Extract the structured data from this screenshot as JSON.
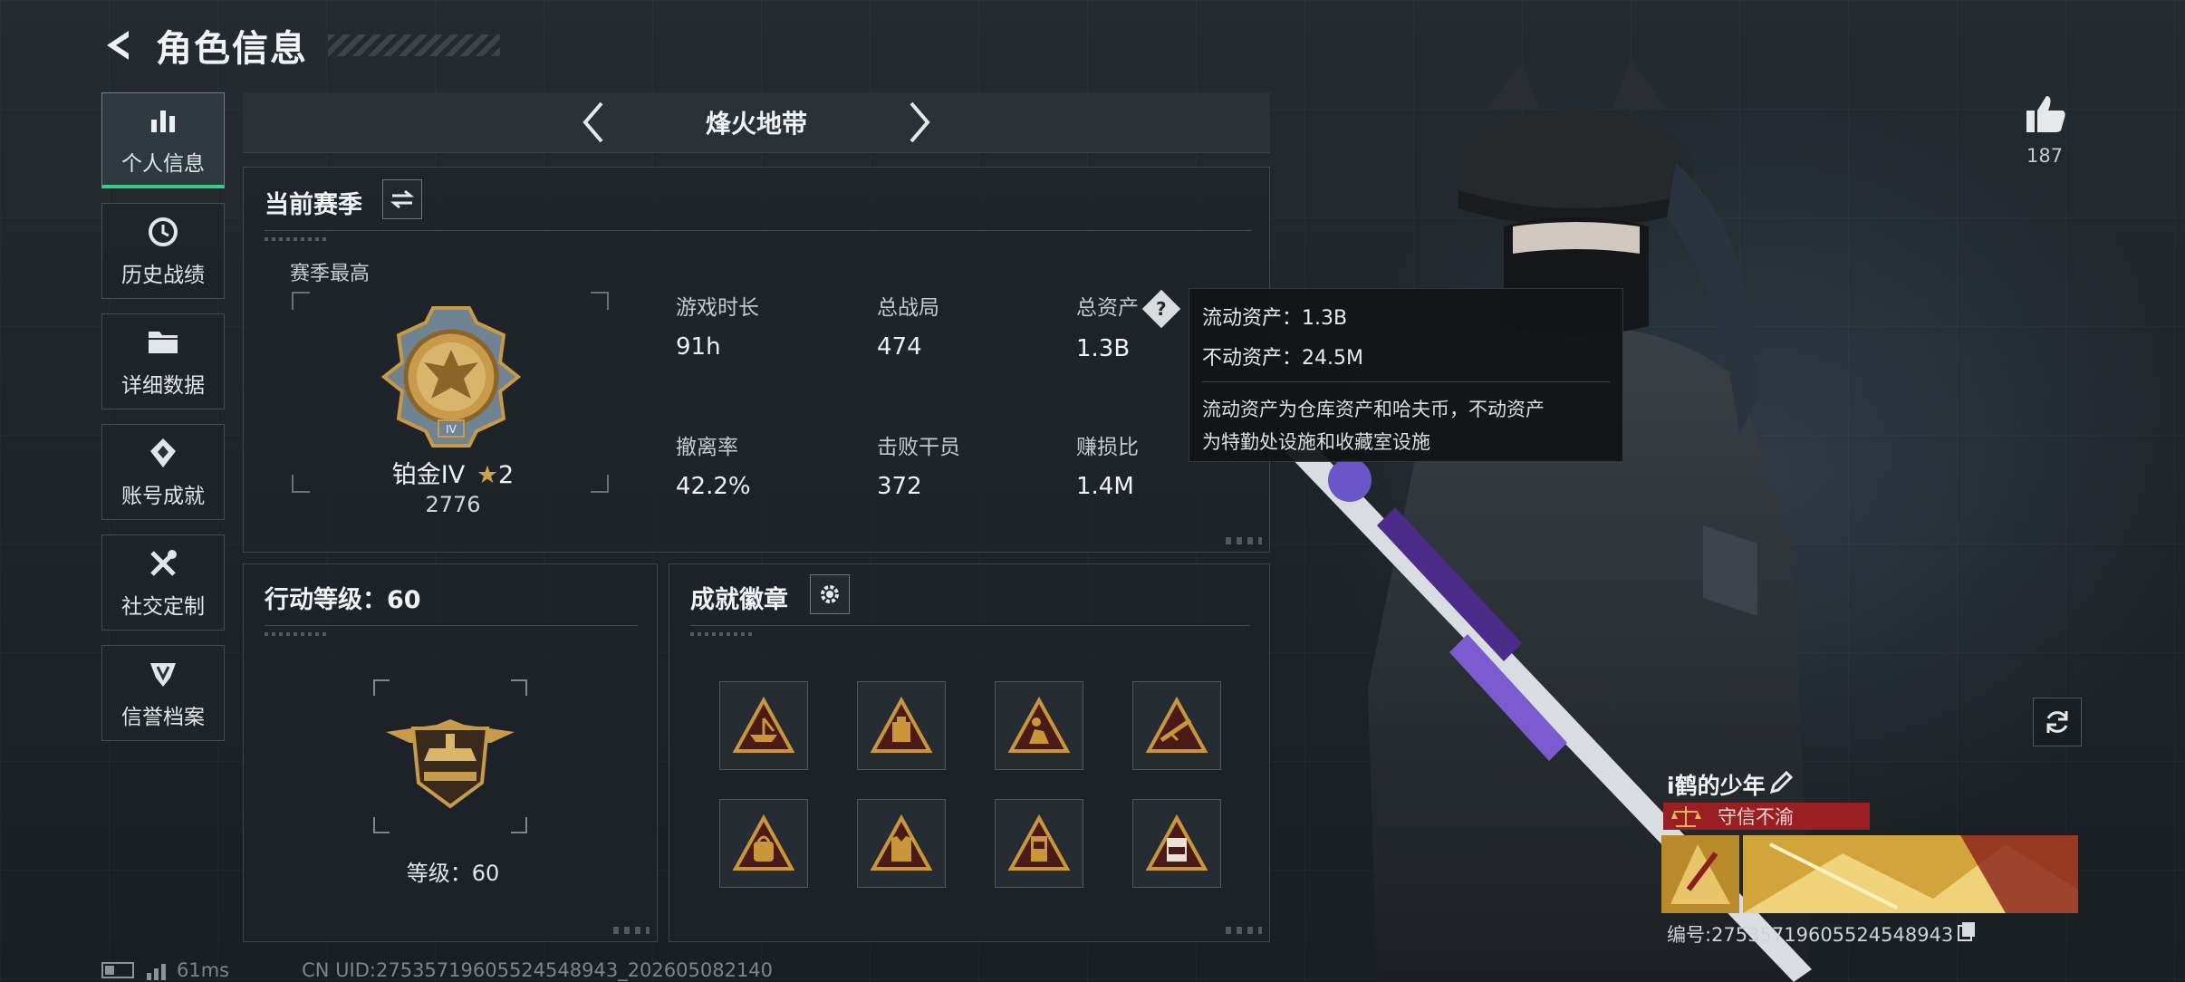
{
  "header": {
    "title": "角色信息"
  },
  "sidebar": {
    "items": [
      {
        "label": "个人信息",
        "active": true
      },
      {
        "label": "历史战绩"
      },
      {
        "label": "详细数据"
      },
      {
        "label": "账号成就"
      },
      {
        "label": "社交定制"
      },
      {
        "label": "信誉档案"
      }
    ]
  },
  "mode": {
    "name": "烽火地带"
  },
  "season": {
    "title": "当前赛季",
    "best_label": "赛季最高",
    "rank_name": "铂金IV",
    "rank_stars": "2",
    "rank_score": "2776",
    "stats": [
      {
        "label": "游戏时长",
        "value": "91h"
      },
      {
        "label": "总战局",
        "value": "474"
      },
      {
        "label": "总资产",
        "value": "1.3B"
      },
      {
        "label": "撤离率",
        "value": "42.2%"
      },
      {
        "label": "击败干员",
        "value": "372"
      },
      {
        "label": "赚损比",
        "value": "1.4M"
      }
    ],
    "help_glyph": "?"
  },
  "tooltip": {
    "liquid": "流动资产：1.3B",
    "fixed": "不动资产：24.5M",
    "desc_line1": "流动资产为仓库资产和哈夫币，不动资产",
    "desc_line2": "为特勤处设施和收藏室设施"
  },
  "action_level": {
    "title": "行动等级：60",
    "caption": "等级：60"
  },
  "achievements": {
    "title": "成就徽章",
    "badge_count": 8
  },
  "profile": {
    "likes": "187",
    "player_name": "i鹤的少年",
    "trust_label": "守信不渝",
    "player_id": "编号:27535719605524548943"
  },
  "footer": {
    "ping": "61ms",
    "uid": "CN UID:27535719605524548943_202605082140"
  },
  "colors": {
    "accent_green": "#38c98c",
    "trust_red": "#9a1f22",
    "badge_gold": "#c9973a"
  }
}
